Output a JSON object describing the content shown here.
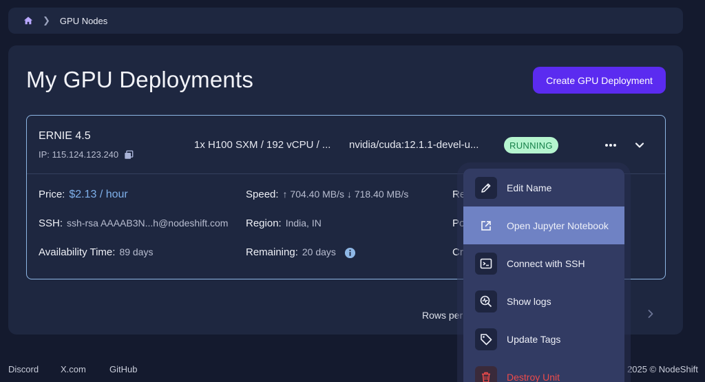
{
  "breadcrumb": {
    "home_icon": "home-icon",
    "current": "GPU Nodes"
  },
  "page": {
    "title": "My GPU Deployments",
    "create_button": "Create GPU Deployment"
  },
  "deployment": {
    "name": "ERNIE 4.5",
    "ip": "IP: 115.124.123.240",
    "spec": "1x H100 SXM / 192 vCPU / ...",
    "image": "nvidia/cuda:12.1.1-devel-u...",
    "status": "RUNNING",
    "status_color": "#b5f5cf",
    "price_label": "Price:",
    "price_value": "$2.13 / hour",
    "speed_label": "Speed:",
    "speed_value": "↑ 704.40 MB/s ↓ 718.40 MB/s",
    "ssh_label": "SSH:",
    "ssh_value": "ssh-rsa AAAAB3N...h@nodeshift.com",
    "region_label": "Region:",
    "region_value": "India, IN",
    "availability_label": "Availability Time:",
    "availability_value": "89 days",
    "remaining_label": "Remaining:",
    "remaining_value": "20 days",
    "col3_row1_label": "Re",
    "col3_row2_label": "Po",
    "col3_row3_label": "Cr"
  },
  "pagination": {
    "rows_per_page_label": "Rows per"
  },
  "menu": {
    "items": [
      {
        "label": "Edit Name",
        "icon": "pencil-icon"
      },
      {
        "label": "Open Jupyter Notebook",
        "icon": "open-external-icon"
      },
      {
        "label": "Connect with SSH",
        "icon": "terminal-icon"
      },
      {
        "label": "Show logs",
        "icon": "logs-search-icon"
      },
      {
        "label": "Update Tags",
        "icon": "tag-icon"
      },
      {
        "label": "Destroy Unit",
        "icon": "trash-icon"
      }
    ]
  },
  "footer": {
    "links": [
      "Discord",
      "X.com",
      "GitHub"
    ],
    "copyright": "2025 © NodeShift"
  },
  "colors": {
    "accent": "#5b2bf0",
    "card_border": "#8fb8e6",
    "price": "#7fb0ea",
    "danger": "#ef4b4b"
  }
}
